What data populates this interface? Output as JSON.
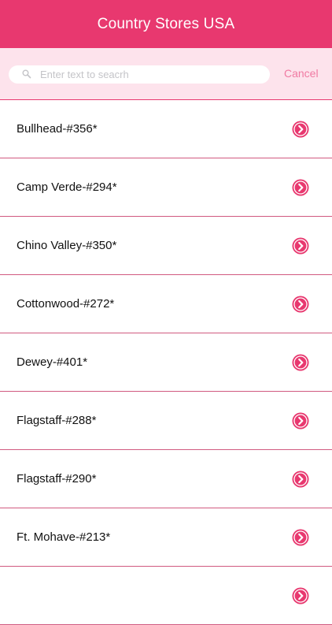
{
  "header": {
    "title": "Country Stores USA"
  },
  "search": {
    "placeholder": "Enter text to seacrh",
    "value": "",
    "cancel_label": "Cancel"
  },
  "stores": [
    {
      "name": "Bullhead-#356*"
    },
    {
      "name": "Camp Verde-#294*"
    },
    {
      "name": "Chino Valley-#350*"
    },
    {
      "name": "Cottonwood-#272*"
    },
    {
      "name": "Dewey-#401*"
    },
    {
      "name": "Flagstaff-#288*"
    },
    {
      "name": "Flagstaff-#290*"
    },
    {
      "name": "Ft. Mohave-#213*"
    },
    {
      "name": ""
    }
  ],
  "colors": {
    "accent": "#e8386f",
    "search_bg": "#fde3ec",
    "cancel": "#f07aa2"
  },
  "icons": {
    "row_action": "chevron-right-circle-icon",
    "search": "search-icon"
  }
}
